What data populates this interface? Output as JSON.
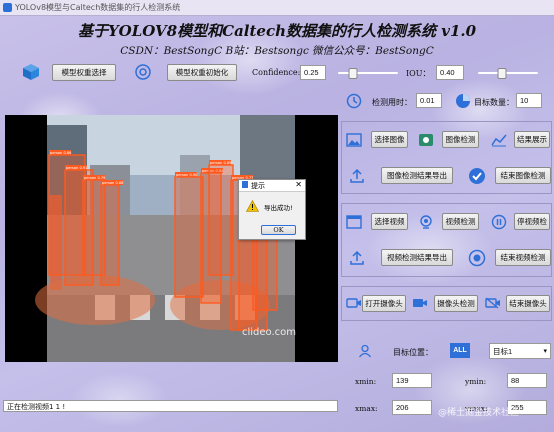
{
  "window": {
    "title": "YOLOv8模型与Caltech数据集的行人检测系统"
  },
  "header": {
    "title": "基于YOLOV8模型和Caltech数据集的行人检测系统 v1.0",
    "subtitle": "CSDN：BestSongC   B站：Bestsongc   微信公众号：BestSongC"
  },
  "toolbar": {
    "select_weights": "模型权重选择",
    "init_weights": "模型权重初始化",
    "confidence_label": "Confidence:",
    "confidence_value": "0.25",
    "confidence_level": 0.25,
    "iou_label": "IOU：",
    "iou_value": "0.40",
    "iou_level": 0.4
  },
  "stats": {
    "time_label": "检测用时：",
    "time_value": "0.01",
    "count_label": "目标数量：",
    "count_value": "10"
  },
  "image_row": {
    "select": "选择图像",
    "detect": "图像检测",
    "show": "结果展示",
    "export": "图像检测结果导出",
    "finish": "结束图像检测"
  },
  "video_row": {
    "select": "选择视频",
    "detect": "视频检测",
    "pause": "停视频检",
    "export": "视频检测结果导出",
    "finish": "结束视频检测"
  },
  "camera_row": {
    "open": "打开摄像头",
    "detect": "摄像头检测",
    "close": "结束摄像头"
  },
  "target": {
    "label": "目标位置：",
    "all_badge": "ALL",
    "selected": "目标1",
    "xmin_label": "xmin:",
    "xmin": "139",
    "ymin_label": "ymin:",
    "ymin": "88",
    "xmax_label": "xmax:",
    "xmax": "206",
    "ymax_label": "ymax:",
    "ymax": "255"
  },
  "dialog": {
    "title": "提示",
    "message": "导出成功!",
    "ok": "OK"
  },
  "status_text": "正在检测视频1 1 !",
  "watermarks": {
    "video": "clideo.com",
    "corner": "@稀土掘金技术社区"
  },
  "detections": [
    {
      "label": "person 0.86"
    },
    {
      "label": "person 0.91"
    },
    {
      "label": "person 0.79"
    },
    {
      "label": "person 0.88"
    },
    {
      "label": "person 0.90"
    },
    {
      "label": "person 0.84"
    },
    {
      "label": "person 0.89"
    },
    {
      "label": "person 0.77"
    },
    {
      "label": "person 0.73"
    },
    {
      "label": "person 0.81"
    }
  ],
  "colors": {
    "accent": "#2f6fd8",
    "box": "#ff5a1f"
  }
}
